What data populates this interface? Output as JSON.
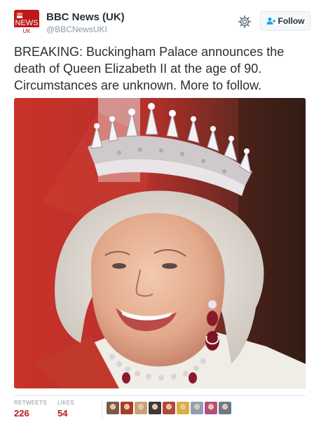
{
  "header": {
    "avatar": {
      "top_text": "BBC",
      "middle_text": "NEWS",
      "bottom_text": "UK",
      "color": "#bb1919"
    },
    "display_name": "BBC News (UK)",
    "handle": "@BBCNewsUKI",
    "settings_icon": "gear-icon",
    "follow_label": "Follow",
    "follow_icon": "add-user-icon"
  },
  "tweet": {
    "text": "BREAKING: Buckingham Palace announces the death of Queen Elizabeth II at the age of 90. Circumstances are unknown. More to follow."
  },
  "stats": {
    "retweets_label": "RETWEETS",
    "retweets_count": "226",
    "likes_label": "LIKES",
    "likes_count": "54",
    "liker_avatar_colors": [
      "#7a5a4a",
      "#a83a2a",
      "#c9a27a",
      "#3a3a3a",
      "#b04a3a",
      "#d9b040",
      "#8aa0b8",
      "#b05080",
      "#6a7a8a"
    ]
  },
  "colors": {
    "accent": "#bb1919",
    "muted": "#8899a6",
    "text": "#292f33"
  }
}
